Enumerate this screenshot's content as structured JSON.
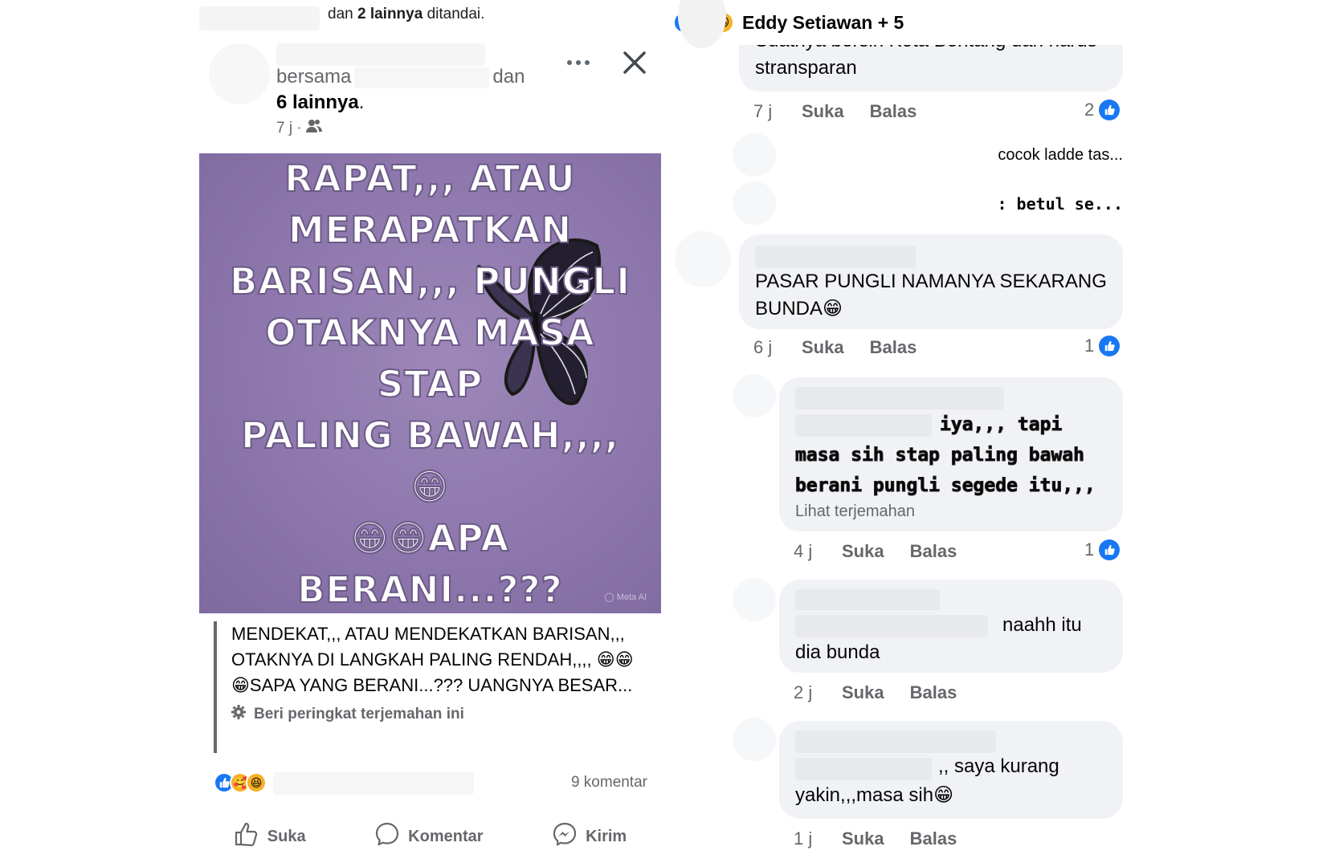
{
  "post": {
    "tagged_prefix": "dan ",
    "tagged_count": "2 lainnya",
    "tagged_suffix": " ditandai.",
    "with_label": "bersama",
    "and_label": "dan",
    "others_label": "6 lainnya",
    "time": "7 j ·",
    "image_text": "RAPAT,,, ATAU\nMERAPATKAN\nBARISAN,,, PUNGLI\nOTAKNYA MASA STAP\nPALING BAWAH,,,, 😁\n😁😁APA BERANI...???\nDANANYA GEDEEE\nLHO...",
    "translation_text": "MENDEKAT,,, ATAU MENDEKATKAN BARISAN,,, OTAKNYA DI LANGKAH PALING RENDAH,,,, 😁😁😁SAPA YANG BERANI...??? UANGNYA BESAR...",
    "rate_translation": "Beri peringkat terjemahan ini",
    "comment_count": "9 komentar",
    "actions": {
      "like": "Suka",
      "comment": "Komentar",
      "send": "Kirim"
    },
    "watermark": "Meta AI"
  },
  "reactions_header": {
    "names": "Eddy Setiawan + 5"
  },
  "comments": [
    {
      "text": "Suatnya bersih  Kota Bontang dan harus stransparan",
      "time": "7 j",
      "like": "Suka",
      "reply": "Balas",
      "likes": "2"
    },
    {
      "collapsed": "cocok ladde tas..."
    },
    {
      "collapsed": ": betul se..."
    },
    {
      "text": "PASAR PUNGLI NAMANYA SEKARANG BUNDA😁",
      "time": "6 j",
      "like": "Suka",
      "reply": "Balas",
      "likes": "1"
    },
    {
      "text": "iya,,, tapi masa sih stap paling bawah berani pungli segede itu,,,",
      "see_translation": "Lihat terjemahan",
      "time": "4 j",
      "like": "Suka",
      "reply": "Balas",
      "likes": "1"
    },
    {
      "text_a": "naahh itu",
      "text_b": "dia bunda",
      "time": "2 j",
      "like": "Suka",
      "reply": "Balas"
    },
    {
      "text_a": ",, saya kurang",
      "text_b": "yakin,,,masa sih😁",
      "time": "1 j",
      "like": "Suka",
      "reply": "Balas"
    }
  ],
  "colors": {
    "like_blue": "#1877f2",
    "bubble_bg": "#f0f2f5",
    "image_purple": "#8e78ad",
    "muted": "#65676b"
  },
  "icons": [
    "more-icon",
    "close-icon",
    "friends-icon",
    "gear-icon",
    "like-icon",
    "comment-icon",
    "messenger-icon",
    "butterfly-image"
  ]
}
